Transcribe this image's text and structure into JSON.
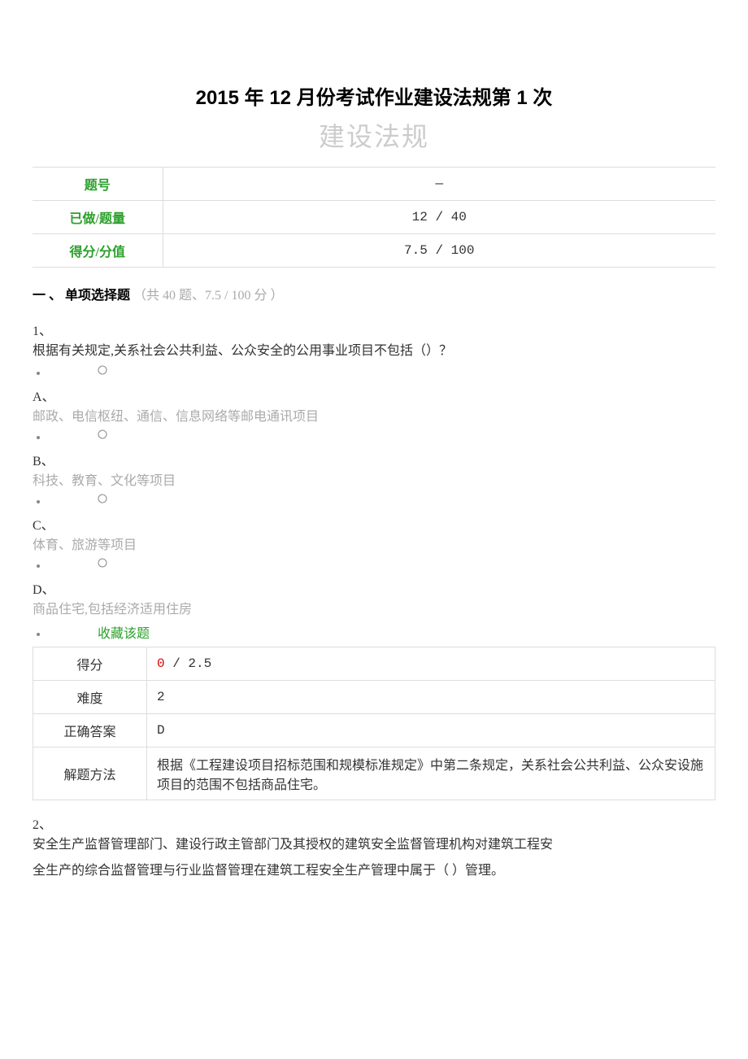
{
  "header": {
    "main_title": "2015 年 12 月份考试作业建设法规第 1 次",
    "sub_title": "建设法规"
  },
  "summary": {
    "rows": [
      {
        "label": "题号",
        "value": "—"
      },
      {
        "label": "已做/题量",
        "value": "12 / 40"
      },
      {
        "label": "得分/分值",
        "value": "7.5 / 100"
      }
    ]
  },
  "section": {
    "prefix": "一 、",
    "title": "单项选择题",
    "stats": "（共 40 题、7.5 / 100 分 ）"
  },
  "q1": {
    "num": "1、",
    "text": "根据有关规定,关系社会公共利益、公众安全的公用事业项目不包括（）？",
    "options": {
      "A": {
        "label": "A、",
        "text": "邮政、电信枢纽、通信、信息网络等邮电通讯项目"
      },
      "B": {
        "label": "B、",
        "text": "科技、教育、文化等项目"
      },
      "C": {
        "label": "C、",
        "text": "体育、旅游等项目"
      },
      "D": {
        "label": "D、",
        "text": "商品住宅,包括经济适用住房"
      }
    },
    "favorite": "收藏该题",
    "result": {
      "score_label": "得分",
      "score_got": "0",
      "score_sep": " / ",
      "score_total": "2.5",
      "difficulty_label": "难度",
      "difficulty_value": "2",
      "answer_label": "正确答案",
      "answer_value": "D",
      "method_label": "解题方法",
      "method_value": "根据《工程建设项目招标范围和规模标准规定》中第二条规定，关系社会公共利益、公众安设施项目的范围不包括商品住宅。"
    }
  },
  "q2": {
    "num": "2、",
    "line1": "安全生产监督管理部门、建设行政主管部门及其授权的建筑安全监督管理机构对建筑工程安",
    "line2": "全生产的综合监督管理与行业监督管理在建筑工程安全生产管理中属于（  ）管理。"
  }
}
